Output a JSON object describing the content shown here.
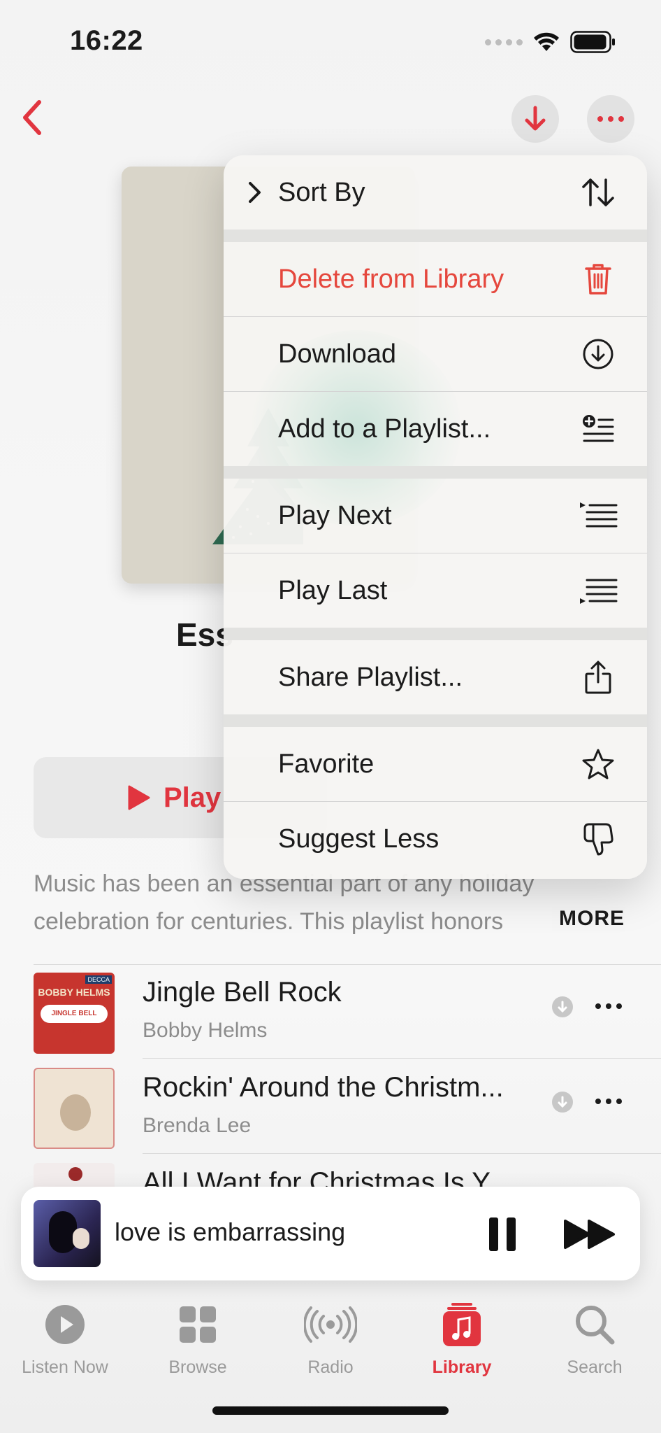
{
  "status_bar": {
    "time": "16:22"
  },
  "menu": {
    "sort_by": "Sort By",
    "delete": "Delete from Library",
    "download": "Download",
    "add_to_playlist": "Add to a Playlist...",
    "play_next": "Play Next",
    "play_last": "Play Last",
    "share": "Share Playlist...",
    "favorite": "Favorite",
    "suggest_less": "Suggest Less"
  },
  "playlist": {
    "title_partial": "Ess",
    "play_label": "Play",
    "description": "Music has been an essential part of any holiday celebration for centuries. This playlist honors",
    "more_label": "MORE"
  },
  "tracks": [
    {
      "title": "Jingle Bell Rock",
      "artist": "Bobby Helms",
      "art_text_top": "BOBBY HELMS",
      "art_text_mid": "JINGLE BELL ROCK",
      "art_badge": "DECCA"
    },
    {
      "title": "Rockin' Around the Christm...",
      "artist": "Brenda Lee"
    },
    {
      "title": "All I Want for Christmas Is Y..."
    }
  ],
  "now_playing": {
    "title": "love is embarrassing"
  },
  "tabs": [
    {
      "label": "Listen Now",
      "icon": "play-circle-icon"
    },
    {
      "label": "Browse",
      "icon": "grid-icon"
    },
    {
      "label": "Radio",
      "icon": "radio-waves-icon"
    },
    {
      "label": "Library",
      "icon": "music-note-stack-icon",
      "active": true
    },
    {
      "label": "Search",
      "icon": "magnifier-icon"
    }
  ],
  "colors": {
    "accent": "#e1353f",
    "destructive": "#e5473d",
    "tree": "#2f6b52"
  }
}
